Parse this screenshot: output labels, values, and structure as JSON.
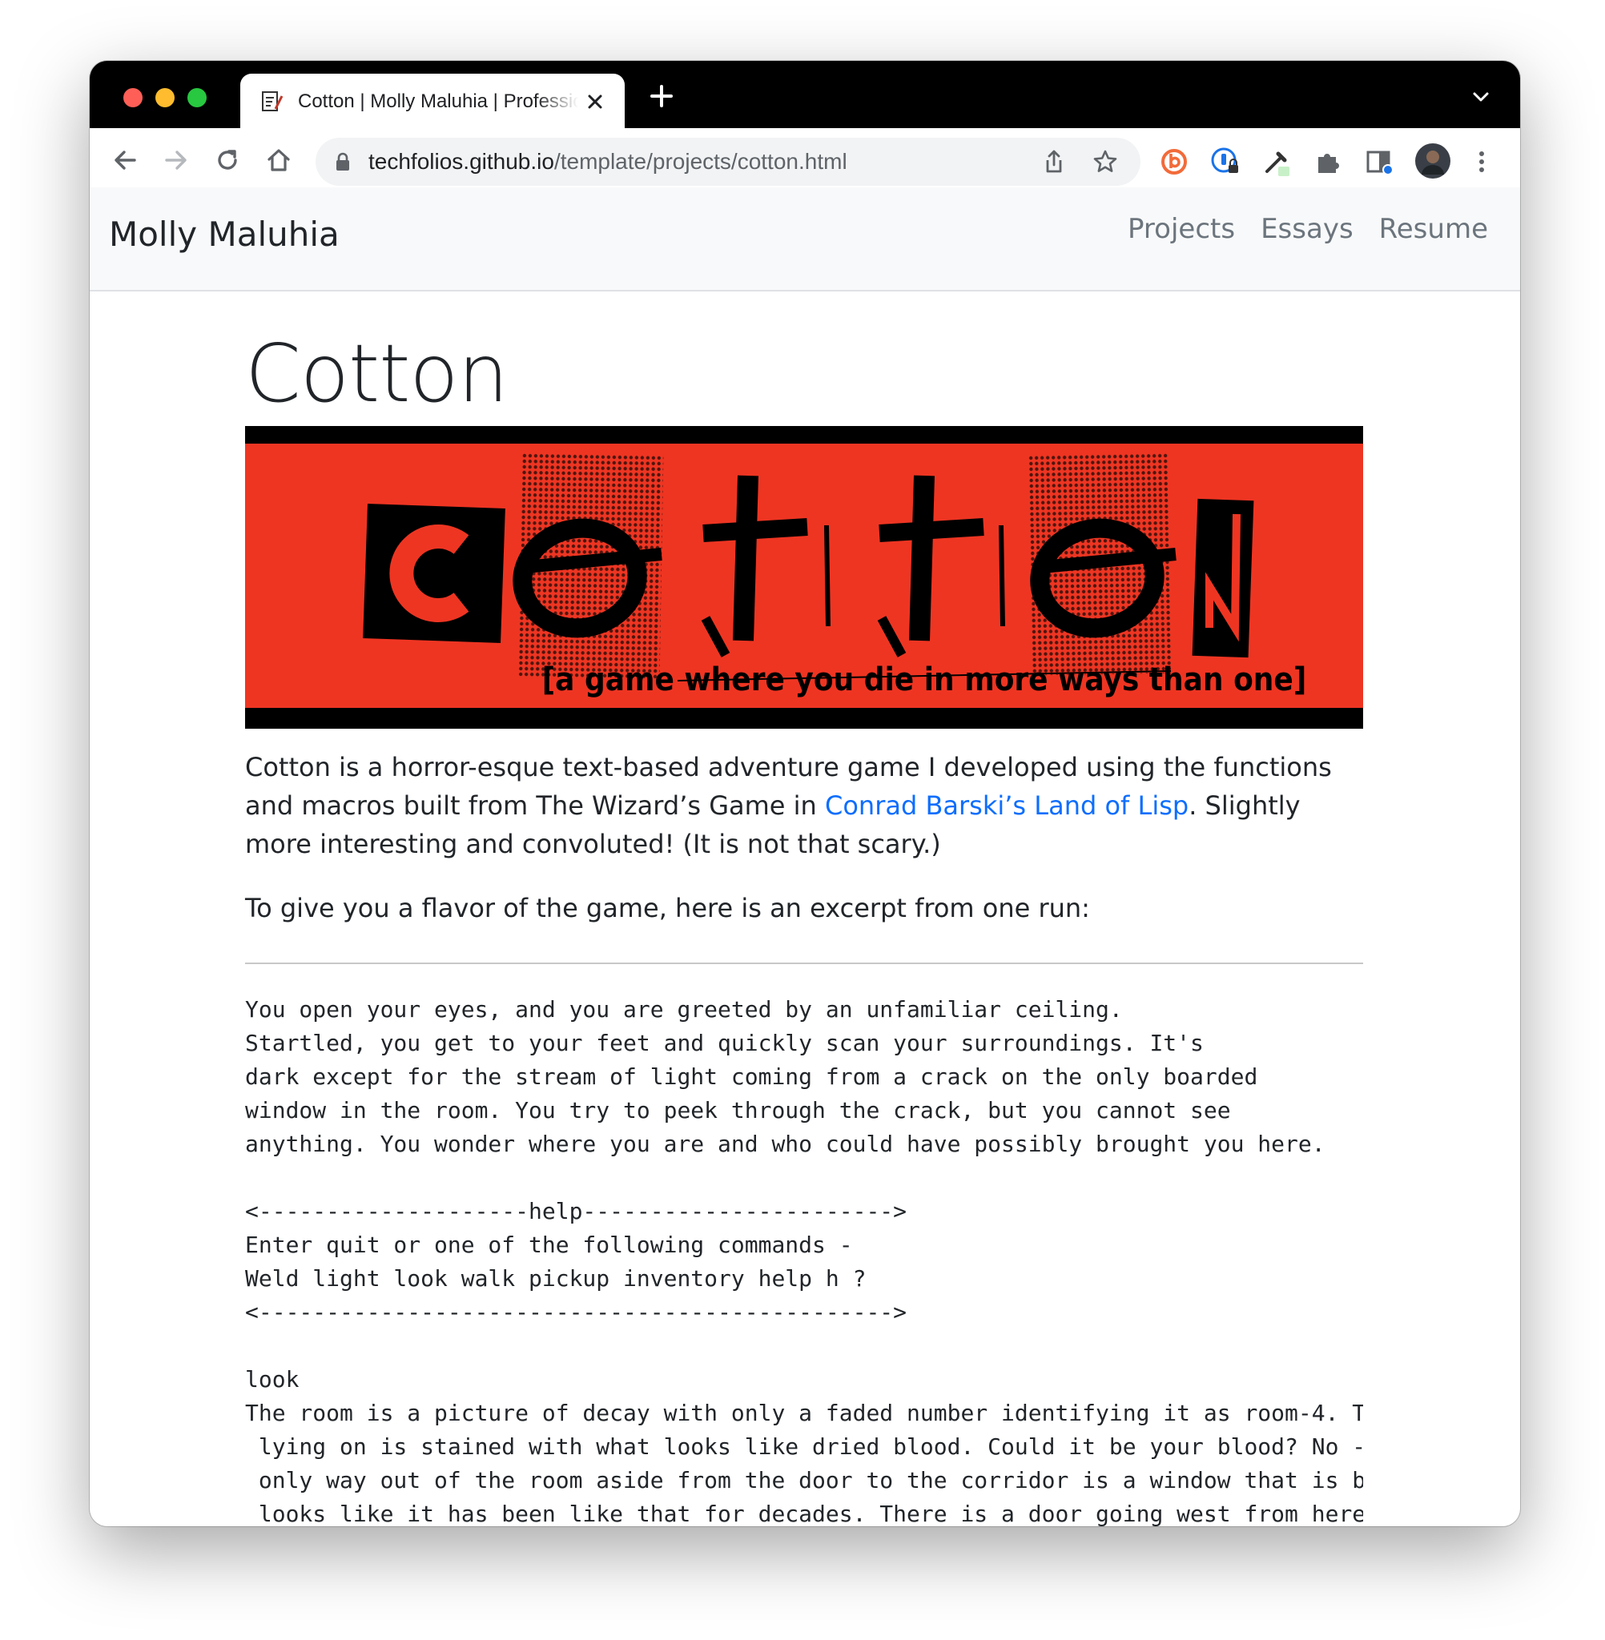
{
  "browser": {
    "tab_title": "Cotton | Molly Maluhia | Professional Portfolio",
    "url_host": "techfolios.github.io",
    "url_path": "/template/projects/cotton.html"
  },
  "site": {
    "brand": "Molly Maluhia",
    "nav": [
      "Projects",
      "Essays",
      "Resume"
    ]
  },
  "page": {
    "title": "Cotton",
    "banner": {
      "word": "cotton",
      "tagline": "[a game where you die in more ways than one]"
    },
    "intro_before_link": "Cotton is a horror-esque text-based adventure game I developed using the functions and macros built from The Wizard’s Game in ",
    "intro_link": "Conrad Barski’s Land of Lisp",
    "intro_after_link": ". Slightly more interesting and convoluted! (It is not that scary.)",
    "excerpt_intro": "To give you a flavor of the game, here is an excerpt from one run:",
    "excerpt": "You open your eyes, and you are greeted by an unfamiliar ceiling.\nStartled, you get to your feet and quickly scan your surroundings. It's\ndark except for the stream of light coming from a crack on the only boarded\nwindow in the room. You try to peek through the crack, but you cannot see\nanything. You wonder where you are and who could have possibly brought you here.\n\n<--------------------help----------------------->\nEnter quit or one of the following commands -\nWeld light look walk pickup inventory help h ?\n<----------------------------------------------->\n\nlook\nThe room is a picture of decay with only a faded number identifying it as room-4. T\n lying on is stained with what looks like dried blood. Could it be your blood? No -\n only way out of the room aside from the door to the corridor is a window that is b\n looks like it has been like that for decades. There is a door going west from here"
  },
  "colors": {
    "banner_red": "#ee3522",
    "link": "#0d6efd",
    "titlebar": "#000000"
  }
}
